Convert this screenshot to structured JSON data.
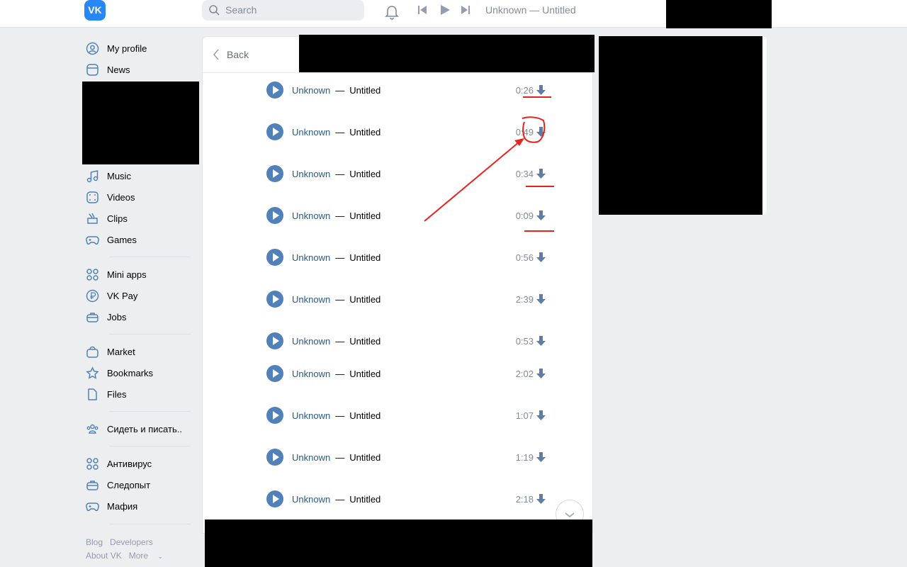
{
  "header": {
    "logo": "VK",
    "search_placeholder": "Search",
    "now_playing": "Unknown — Untitled"
  },
  "sidebar": {
    "items": [
      {
        "label": "My profile",
        "icon": "user-circle-icon"
      },
      {
        "label": "News",
        "icon": "news-icon"
      },
      {
        "label": "Music",
        "icon": "music-icon"
      },
      {
        "label": "Videos",
        "icon": "video-icon"
      },
      {
        "label": "Clips",
        "icon": "clips-icon"
      },
      {
        "label": "Games",
        "icon": "gamepad-icon"
      },
      {
        "label": "Mini apps",
        "icon": "apps-icon"
      },
      {
        "label": "VK Pay",
        "icon": "ruble-icon"
      },
      {
        "label": "Jobs",
        "icon": "briefcase-icon"
      },
      {
        "label": "Market",
        "icon": "bag-icon"
      },
      {
        "label": "Bookmarks",
        "icon": "star-icon"
      },
      {
        "label": "Files",
        "icon": "file-icon"
      },
      {
        "label": "Сидеть и писать..",
        "icon": "community-icon"
      },
      {
        "label": "Антивирус",
        "icon": "apps-icon"
      },
      {
        "label": "Следопыт",
        "icon": "briefcase-icon"
      },
      {
        "label": "Мафия",
        "icon": "gamepad-icon"
      }
    ],
    "footer": [
      "Blog",
      "Developers",
      "About VK",
      "More"
    ]
  },
  "main": {
    "back_label": "Back",
    "tracks": [
      {
        "artist": "Unknown",
        "title": "Untitled",
        "duration": "0:26"
      },
      {
        "artist": "Unknown",
        "title": "Untitled",
        "duration": "0:49"
      },
      {
        "artist": "Unknown",
        "title": "Untitled",
        "duration": "0:34"
      },
      {
        "artist": "Unknown",
        "title": "Untitled",
        "duration": "0:09"
      },
      {
        "artist": "Unknown",
        "title": "Untitled",
        "duration": "0:56"
      },
      {
        "artist": "Unknown",
        "title": "Untitled",
        "duration": "2:39"
      },
      {
        "artist": "Unknown",
        "title": "Untitled",
        "duration": "0:53"
      },
      {
        "artist": "Unknown",
        "title": "Untitled",
        "duration": "2:02"
      },
      {
        "artist": "Unknown",
        "title": "Untitled",
        "duration": "1:07"
      },
      {
        "artist": "Unknown",
        "title": "Untitled",
        "duration": "1:19"
      },
      {
        "artist": "Unknown",
        "title": "Untitled",
        "duration": "2:18"
      }
    ],
    "separator": "—"
  },
  "colors": {
    "accent": "#5181b8",
    "link": "#2a5885",
    "annotation": "#e8231c",
    "background": "#edeef0"
  }
}
